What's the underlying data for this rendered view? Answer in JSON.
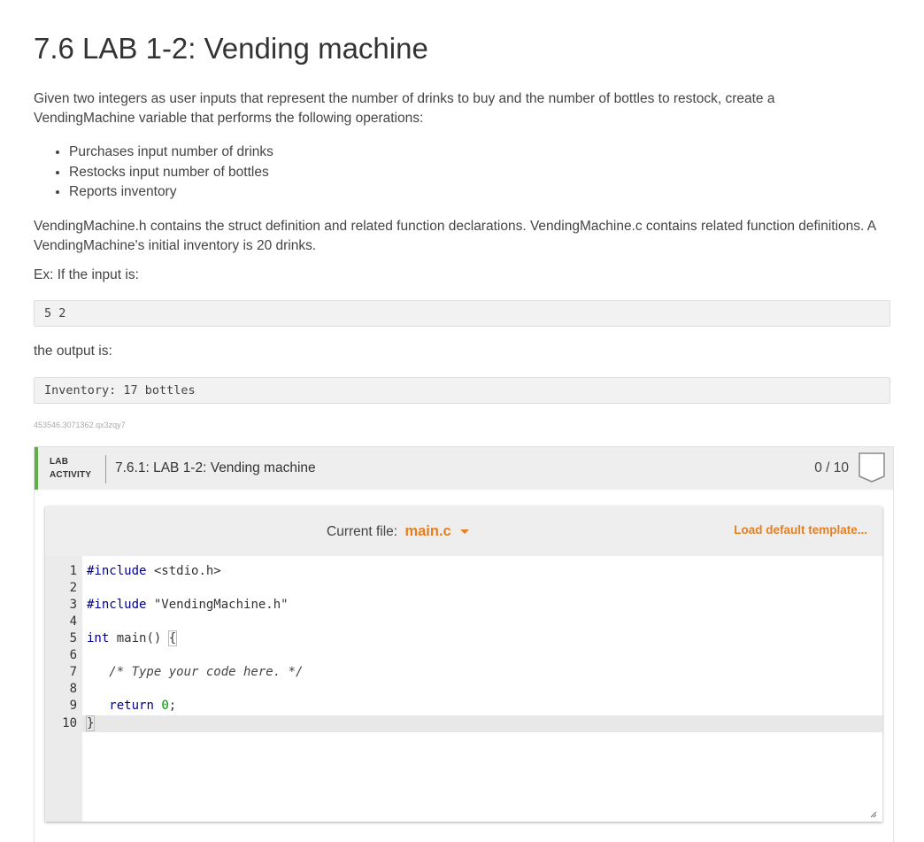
{
  "page": {
    "title": "7.6 LAB 1-2: Vending machine",
    "intro": "Given two integers as user inputs that represent the number of drinks to buy and the number of bottles to restock, create a VendingMachine variable that performs the following operations:",
    "operations": [
      "Purchases input number of drinks",
      "Restocks input number of bottles",
      "Reports inventory"
    ],
    "description": "VendingMachine.h contains the struct definition and related function declarations. VendingMachine.c contains related function definitions. A VendingMachine's initial inventory is 20 drinks.",
    "example_label": "Ex: If the input is:",
    "example_input": "5 2",
    "output_label": "the output is:",
    "example_output": "Inventory: 17 bottles",
    "identifier": "453546.3071362.qx3zqy7"
  },
  "lab": {
    "tag_line1": "LAB",
    "tag_line2": "ACTIVITY",
    "title": "7.6.1: LAB 1-2: Vending machine",
    "score": "0 / 10",
    "accent_color": "#5fae4a"
  },
  "editor": {
    "current_file_label": "Current file:",
    "current_file": "main.c",
    "load_template": "Load default template...",
    "accent_color": "#e57f1f",
    "line_numbers": [
      "1",
      "2",
      "3",
      "4",
      "5",
      "6",
      "7",
      "8",
      "9",
      "10"
    ]
  }
}
